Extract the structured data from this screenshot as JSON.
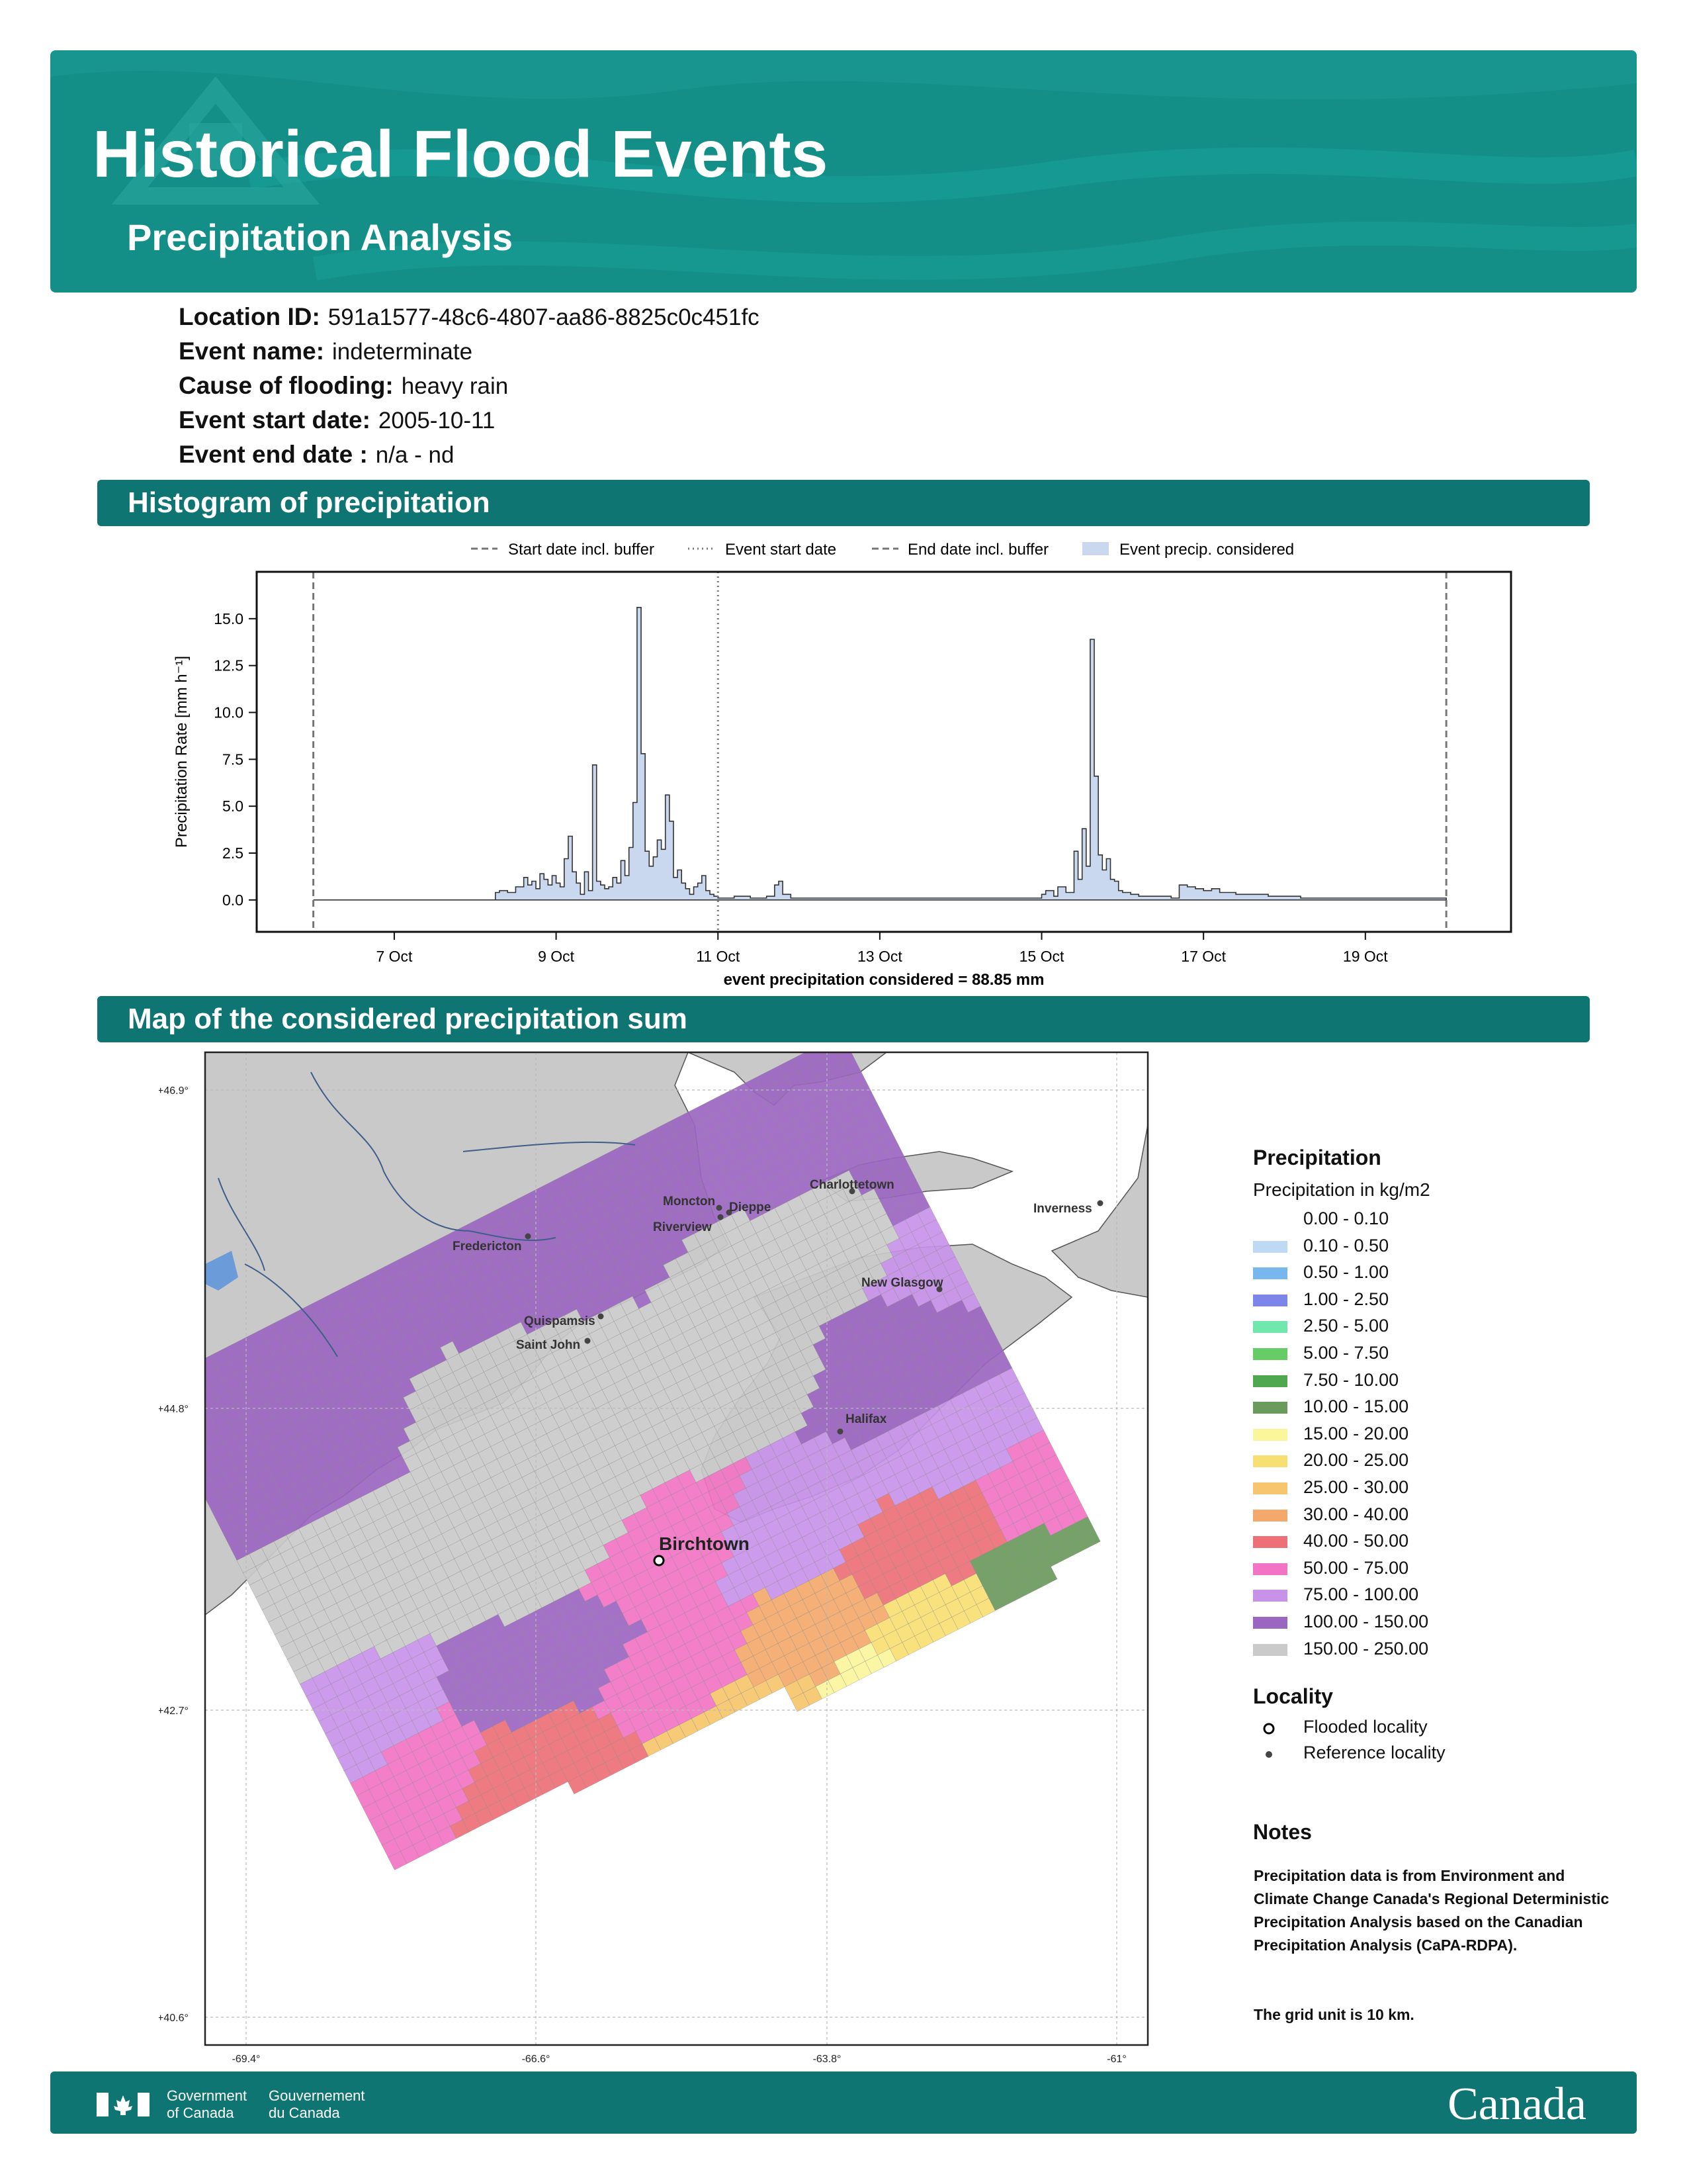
{
  "header": {
    "title": "Historical Flood Events",
    "subtitle": "Precipitation Analysis",
    "bg_color": "#138f88"
  },
  "info": {
    "location_id_label": "Location ID:",
    "location_id": "591a1577-48c6-4807-aa86-8825c0c451fc",
    "event_name_label": "Event name:",
    "event_name": "indeterminate",
    "cause_label": "Cause of flooding:",
    "cause": "heavy rain",
    "start_label": "Event start date:",
    "start": "2005-10-11",
    "end_label": "Event end date :",
    "end": "n/a - nd"
  },
  "sections": {
    "histogram": "Histogram of precipitation",
    "map": "Map of the considered precipitation sum",
    "bar_color": "#0f7572"
  },
  "chart_data": {
    "type": "area",
    "xlabel": "event precipitation considered = 88.85 mm",
    "ylabel": "Precipitation Rate [mm h⁻¹]",
    "ylim": [
      -1.7,
      17.5
    ],
    "yticks": [
      "0.0",
      "2.5",
      "5.0",
      "7.5",
      "10.0",
      "12.5",
      "15.0"
    ],
    "ytick_values": [
      0,
      2.5,
      5,
      7.5,
      10,
      12.5,
      15
    ],
    "xticks": [
      "7 Oct",
      "9 Oct",
      "11 Oct",
      "13 Oct",
      "15 Oct",
      "17 Oct",
      "19 Oct"
    ],
    "xtick_values": [
      7,
      9,
      11,
      13,
      15,
      17,
      19
    ],
    "xlim": [
      5.3,
      20.8
    ],
    "x_units": "days of October 2005",
    "legend": [
      "Start date incl. buffer",
      "Event start date",
      "End date incl. buffer",
      "Event precip. considered"
    ],
    "legend_position": "top",
    "start_buffer": 6.0,
    "event_start": 11.0,
    "end_buffer": 20.0,
    "fill_color": "#c9d8ee",
    "series": [
      {
        "x": [
          6.0,
          8.25,
          8.3,
          8.4,
          8.5,
          8.6,
          8.65,
          8.7,
          8.75,
          8.8,
          8.85,
          8.9,
          8.95,
          9.0,
          9.05,
          9.1,
          9.15,
          9.2,
          9.25,
          9.3,
          9.35,
          9.4,
          9.45,
          9.5,
          9.55,
          9.6,
          9.65,
          9.7,
          9.75,
          9.8,
          9.85,
          9.9,
          9.95,
          10.0,
          10.05,
          10.1,
          10.15,
          10.2,
          10.25,
          10.3,
          10.35,
          10.4,
          10.45,
          10.5,
          10.55,
          10.6,
          10.65,
          10.7,
          10.75,
          10.8,
          10.85,
          10.9,
          10.95,
          11.0,
          11.2,
          11.4,
          11.6,
          11.7,
          11.75,
          11.8,
          11.9,
          12.0,
          15.0,
          15.05,
          15.15,
          15.2,
          15.3,
          15.4,
          15.45,
          15.5,
          15.55,
          15.6,
          15.65,
          15.7,
          15.75,
          15.8,
          15.85,
          15.9,
          15.95,
          16.0,
          16.1,
          16.2,
          16.4,
          16.6,
          16.7,
          16.8,
          16.9,
          17.0,
          17.1,
          17.2,
          17.4,
          17.8,
          18.2,
          20.0
        ],
        "y": [
          0,
          0.4,
          0.5,
          0.4,
          0.7,
          1.2,
          0.8,
          1.0,
          0.6,
          1.4,
          1.1,
          0.8,
          1.3,
          0.9,
          0.7,
          2.2,
          3.4,
          1.5,
          0.9,
          0.3,
          1.5,
          0.5,
          7.2,
          1.0,
          0.8,
          0.6,
          0.7,
          1.2,
          0.9,
          2.1,
          1.3,
          2.8,
          5.2,
          15.6,
          7.8,
          2.6,
          1.8,
          2.3,
          3.2,
          2.7,
          5.6,
          4.2,
          1.2,
          1.6,
          0.9,
          0.6,
          0.3,
          0.7,
          0.9,
          1.3,
          0.5,
          0.3,
          0.2,
          0.1,
          0.2,
          0.1,
          0.2,
          0.8,
          1.0,
          0.3,
          0.1,
          0.1,
          0.3,
          0.5,
          0.2,
          0.7,
          0.4,
          2.6,
          1.1,
          3.8,
          1.8,
          13.9,
          6.6,
          2.4,
          1.6,
          2.2,
          1.1,
          1.0,
          0.5,
          0.4,
          0.3,
          0.2,
          0.2,
          0.1,
          0.8,
          0.7,
          0.6,
          0.5,
          0.6,
          0.4,
          0.3,
          0.2,
          0.1,
          0
        ]
      }
    ]
  },
  "map": {
    "lat_labels": [
      "+46.9°",
      "+44.8°",
      "+42.7°",
      "+40.6°"
    ],
    "lon_labels": [
      "-69.4°",
      "-66.6°",
      "-63.8°",
      "-61°"
    ],
    "flooded_locality": "Birchtown",
    "reference_localities": [
      "Fredericton",
      "Moncton",
      "Dieppe",
      "Riverview",
      "Charlottetown",
      "Inverness",
      "New Glasgow",
      "Quispamsis",
      "Saint John",
      "Halifax"
    ],
    "land_color": "#c9c9c9",
    "sea_color": "#ffffff"
  },
  "legend": {
    "precip_title": "Precipitation",
    "precip_subtitle": "Precipitation in kg/m2",
    "classes": [
      {
        "label": "0.00 - 0.10",
        "color": "#ffffff"
      },
      {
        "label": "0.10 - 0.50",
        "color": "#bdd9f4"
      },
      {
        "label": "0.50 - 1.00",
        "color": "#78b6ee"
      },
      {
        "label": "1.00 - 2.50",
        "color": "#7d86e8"
      },
      {
        "label": "2.50 - 5.00",
        "color": "#6fe7ad"
      },
      {
        "label": "5.00 - 7.50",
        "color": "#66cc66"
      },
      {
        "label": "7.50 - 10.00",
        "color": "#4fa84f"
      },
      {
        "label": "10.00 - 15.00",
        "color": "#6a9a5c"
      },
      {
        "label": "15.00 - 20.00",
        "color": "#fbf59b"
      },
      {
        "label": "20.00 - 25.00",
        "color": "#f8df73"
      },
      {
        "label": "25.00 - 30.00",
        "color": "#f6c56d"
      },
      {
        "label": "30.00 - 40.00",
        "color": "#f3a96b"
      },
      {
        "label": "40.00 - 50.00",
        "color": "#ee7077"
      },
      {
        "label": "50.00 - 75.00",
        "color": "#f274c4"
      },
      {
        "label": "75.00 - 100.00",
        "color": "#c892e9"
      },
      {
        "label": "100.00 - 150.00",
        "color": "#9b66c2"
      },
      {
        "label": "150.00 - 250.00",
        "color": "#cacaca"
      }
    ],
    "locality_title": "Locality",
    "flooded_label": "Flooded locality",
    "reference_label": "Reference locality"
  },
  "notes": {
    "title": "Notes",
    "text1": "Precipitation data is from Environment and Climate Change Canada's Regional Deterministic Precipitation Analysis based on the Canadian Precipitation Analysis (CaPA-RDPA).",
    "text2": "The grid unit is 10 km."
  },
  "footer": {
    "gov_en_1": "Government",
    "gov_en_2": "of Canada",
    "gov_fr_1": "Gouvernement",
    "gov_fr_2": "du Canada",
    "wordmark": "Canada"
  }
}
